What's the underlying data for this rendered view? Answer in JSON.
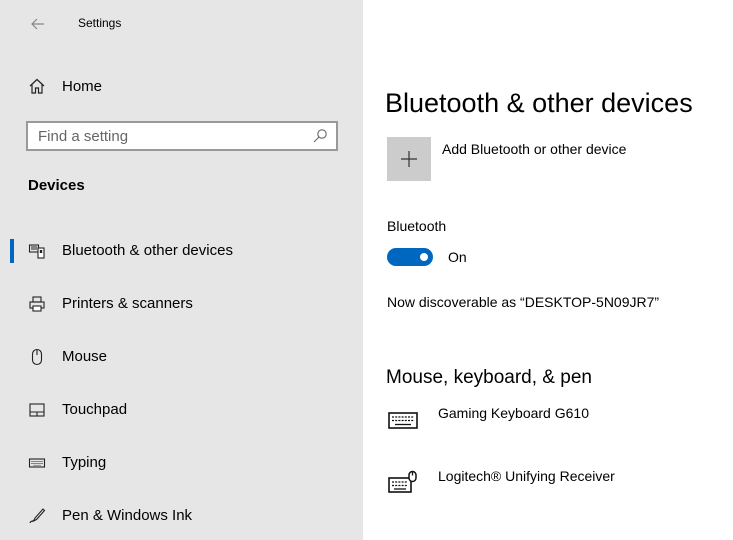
{
  "app": {
    "title": "Settings"
  },
  "sidebar": {
    "home_label": "Home",
    "search_placeholder": "Find a setting",
    "section_title": "Devices",
    "items": [
      {
        "label": "Bluetooth & other devices",
        "icon": "bluetooth-devices-icon",
        "selected": true
      },
      {
        "label": "Printers & scanners",
        "icon": "printer-icon",
        "selected": false
      },
      {
        "label": "Mouse",
        "icon": "mouse-icon",
        "selected": false
      },
      {
        "label": "Touchpad",
        "icon": "touchpad-icon",
        "selected": false
      },
      {
        "label": "Typing",
        "icon": "keyboard-icon",
        "selected": false
      },
      {
        "label": "Pen & Windows Ink",
        "icon": "pen-icon",
        "selected": false
      }
    ]
  },
  "main": {
    "title": "Bluetooth & other devices",
    "add_device_label": "Add Bluetooth or other device",
    "bluetooth_label": "Bluetooth",
    "bluetooth_state": "On",
    "discoverable_text": "Now discoverable as “DESKTOP-5N09JR7”",
    "section_title": "Mouse, keyboard, & pen",
    "devices": [
      {
        "name": "Gaming Keyboard G610",
        "icon": "keyboard-icon"
      },
      {
        "name": "Logitech® Unifying Receiver",
        "icon": "keyboard-mouse-icon"
      }
    ]
  },
  "colors": {
    "accent": "#0067c0",
    "sidebar_bg": "#e6e6e6",
    "tile_bg": "#cccccc"
  }
}
